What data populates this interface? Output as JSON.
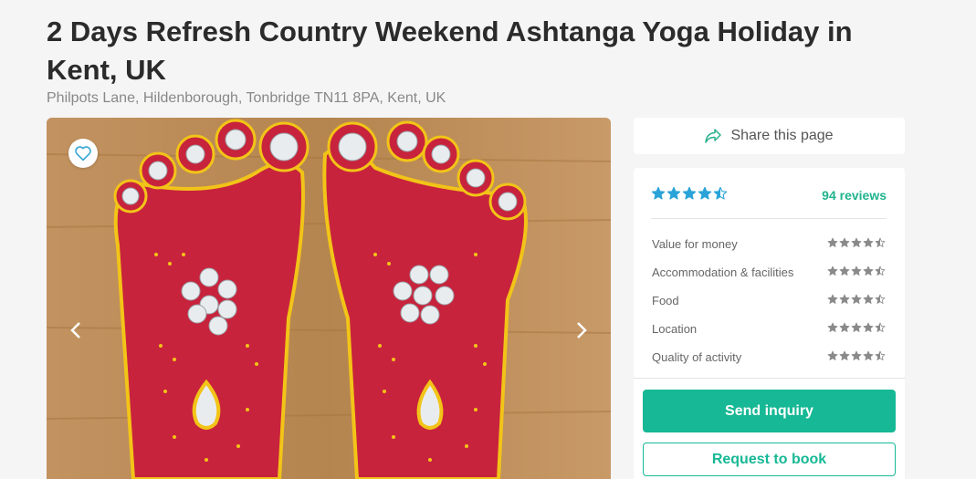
{
  "listing": {
    "title": "2 Days Refresh Country Weekend Ashtanga Yoga Holiday in Kent, UK",
    "address": "Philpots Lane, Hildenborough, Tonbridge TN11 8PA, Kent, UK"
  },
  "gallery": {
    "favorite_icon": "heart-outline-icon",
    "prev_icon": "chevron-left-icon",
    "next_icon": "chevron-right-icon"
  },
  "share": {
    "label": "Share this page",
    "icon": "share-arrow-icon"
  },
  "reviews": {
    "overall_rating": 4.5,
    "count_label": "94 reviews",
    "categories": [
      {
        "label": "Value for money",
        "rating": 4.5
      },
      {
        "label": "Accommodation & facilities",
        "rating": 4.5
      },
      {
        "label": "Food",
        "rating": 4.5
      },
      {
        "label": "Location",
        "rating": 4.5
      },
      {
        "label": "Quality of activity",
        "rating": 4.5
      }
    ]
  },
  "actions": {
    "send_inquiry": "Send inquiry",
    "request_to_book": "Request to book"
  },
  "colors": {
    "accent": "#17b895",
    "star_overall": "#2aa3d8",
    "star_category": "#8a8a8a"
  }
}
